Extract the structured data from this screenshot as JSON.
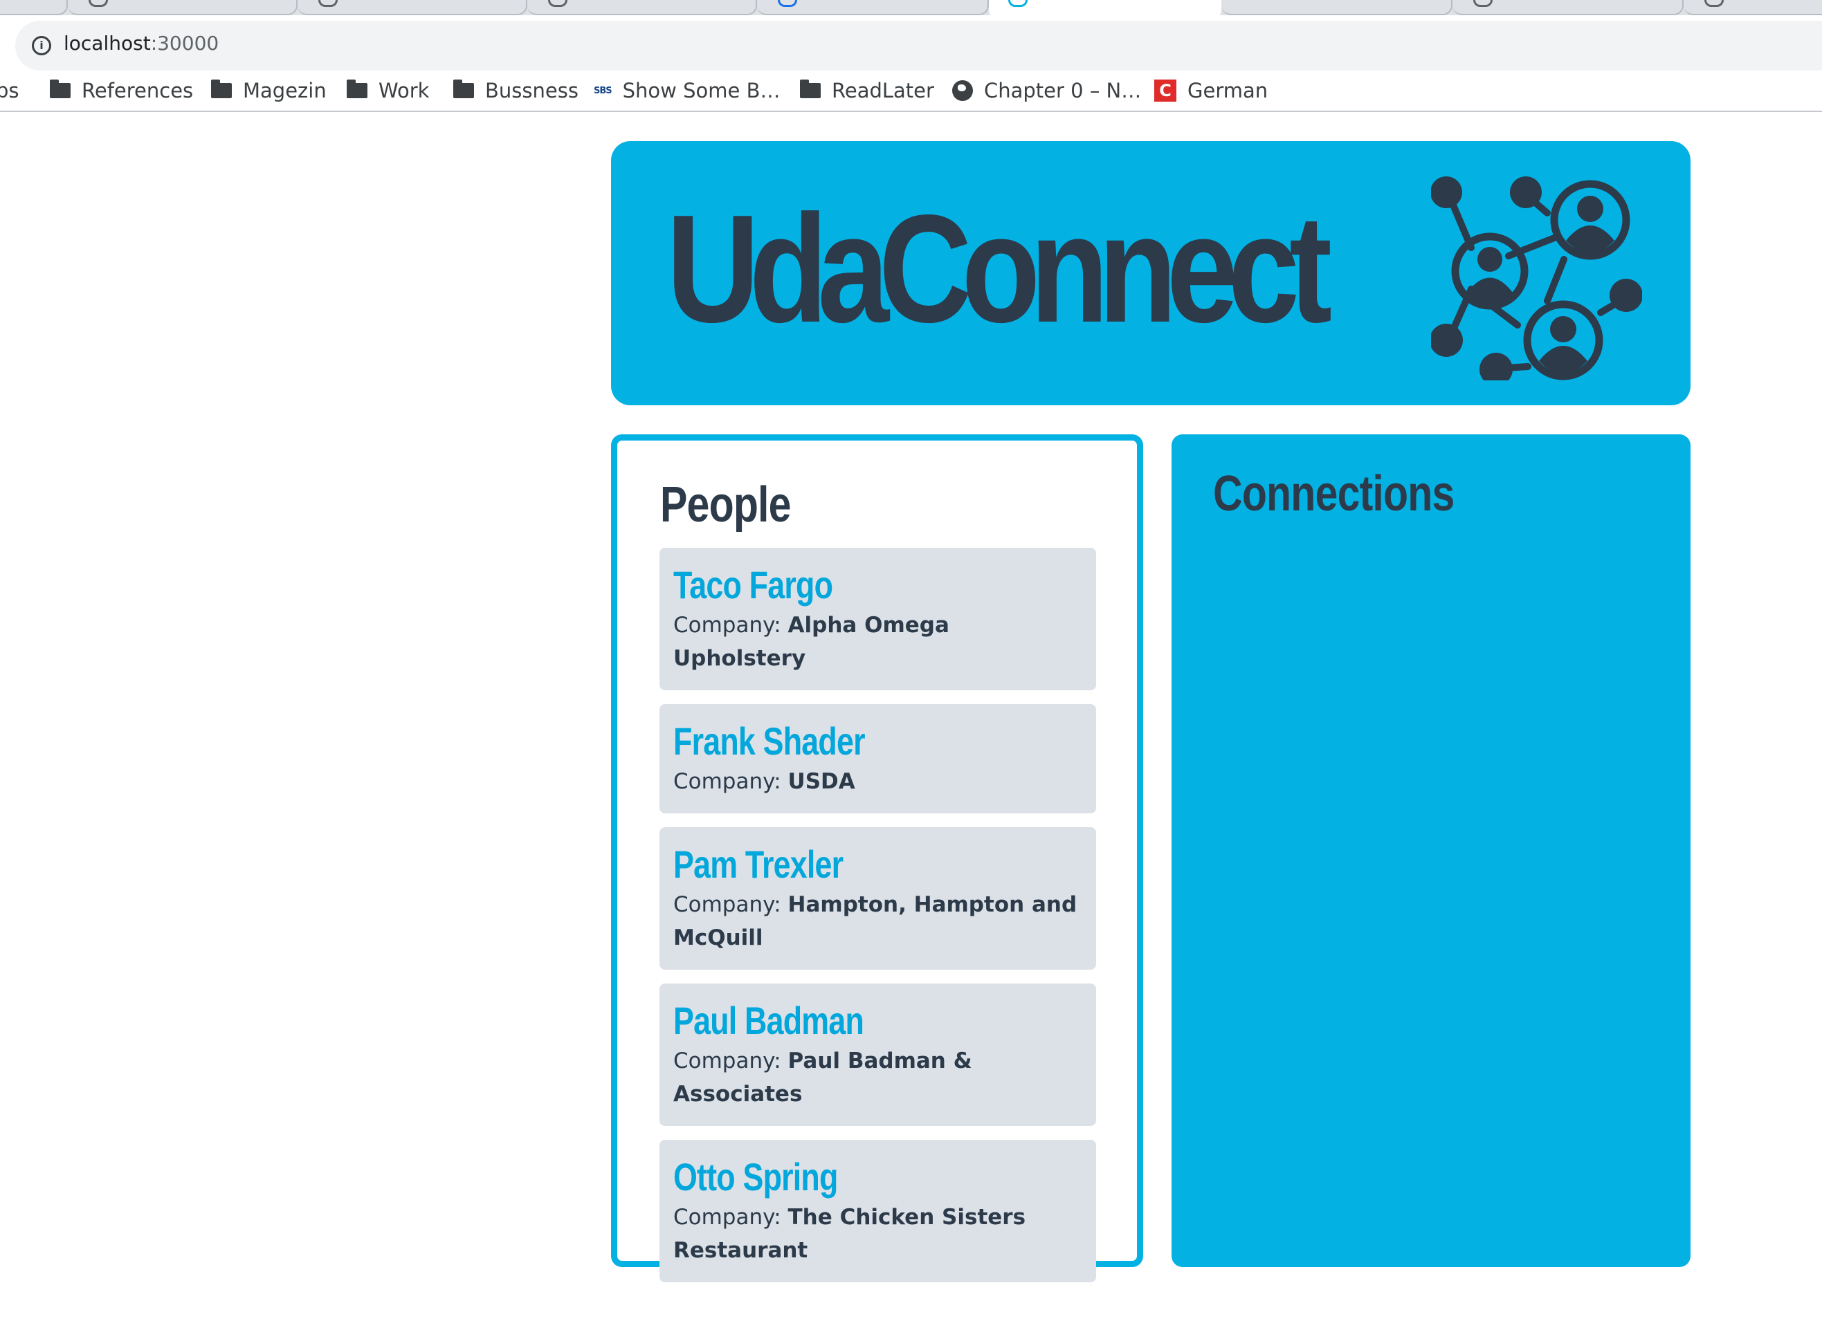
{
  "browser": {
    "url_host": "localhost",
    "url_port": ":30000",
    "bookmarks": [
      {
        "label": "ps",
        "icon": "folder-icon"
      },
      {
        "label": "References",
        "icon": "folder-icon"
      },
      {
        "label": "Magezin",
        "icon": "folder-icon"
      },
      {
        "label": "Work",
        "icon": "folder-icon"
      },
      {
        "label": "Bussness",
        "icon": "folder-icon"
      },
      {
        "label": "Show Some B…",
        "icon": "sbs-icon",
        "icon_text": "SBS"
      },
      {
        "label": "ReadLater",
        "icon": "folder-icon"
      },
      {
        "label": "Chapter 0 – N…",
        "icon": "globe-icon"
      },
      {
        "label": "German",
        "icon": "c-icon",
        "icon_text": "C"
      }
    ]
  },
  "header": {
    "title": "UdaConnect",
    "logo": "network-people-icon"
  },
  "people": {
    "heading": "People",
    "company_label": "Company:",
    "items": [
      {
        "name": "Taco Fargo",
        "company": "Alpha Omega Upholstery"
      },
      {
        "name": "Frank Shader",
        "company": "USDA"
      },
      {
        "name": "Pam Trexler",
        "company": "Hampton, Hampton and McQuill"
      },
      {
        "name": "Paul Badman",
        "company": "Paul Badman & Associates"
      },
      {
        "name": "Otto Spring",
        "company": "The Chicken Sisters Restaurant"
      }
    ]
  },
  "connections": {
    "heading": "Connections"
  },
  "colors": {
    "accent": "#03b1e3",
    "dark": "#2c3a4a",
    "card": "#dbe1e7"
  }
}
